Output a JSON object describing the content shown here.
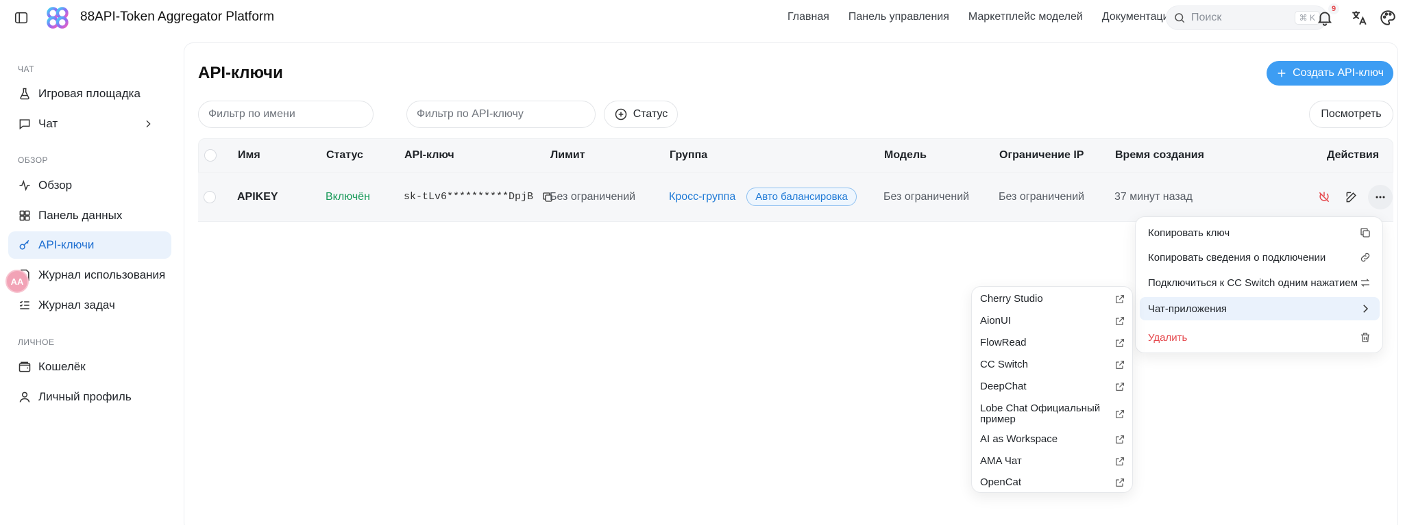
{
  "brand": {
    "name": "88API-Token Aggregator Platform"
  },
  "topnav": [
    "Главная",
    "Панель управления",
    "Маркетплейс моделей",
    "Документация"
  ],
  "search": {
    "placeholder": "Поиск",
    "shortcut": "⌘ K"
  },
  "notifications": {
    "count": "9"
  },
  "sidebar": {
    "sections": [
      {
        "title": "ЧАТ",
        "items": [
          {
            "label": "Игровая площадка",
            "icon": "flask-icon"
          },
          {
            "label": "Чат",
            "icon": "chat-icon"
          }
        ]
      },
      {
        "title": "ОБЗОР",
        "items": [
          {
            "label": "Обзор",
            "icon": "activity-icon"
          },
          {
            "label": "Панель данных",
            "icon": "grid-icon"
          },
          {
            "label": "API-ключи",
            "icon": "key-icon",
            "active": true
          },
          {
            "label": "Журнал использования",
            "icon": "document-icon"
          },
          {
            "label": "Журнал задач",
            "icon": "list-check-icon"
          }
        ]
      },
      {
        "title": "ЛИЧНОЕ",
        "items": [
          {
            "label": "Кошелёк",
            "icon": "wallet-icon"
          },
          {
            "label": "Личный профиль",
            "icon": "user-icon"
          }
        ]
      }
    ],
    "avatar_text": "AA"
  },
  "page": {
    "title": "API-ключи",
    "create_label": "Создать API-ключ",
    "filter_name_placeholder": "Фильтр по имени",
    "filter_key_placeholder": "Фильтр по API-ключу",
    "status_label": "Статус",
    "view_label": "Посмотреть"
  },
  "table": {
    "columns": [
      "Имя",
      "Статус",
      "API-ключ",
      "Лимит",
      "Группа",
      "Модель",
      "Ограничение IP",
      "Время создания",
      "Действия"
    ],
    "rows": [
      {
        "name": "APIKEY",
        "status": "Включён",
        "key": "sk-tLv6**********DpjB",
        "limit": "Без ограничений",
        "group": "Кросс-группа",
        "group_tag": "Авто балансировка",
        "model": "Без ограничений",
        "ip": "Без ограничений",
        "created": "37 минут назад"
      }
    ]
  },
  "menu": {
    "items": [
      "Копировать ключ",
      "Копировать сведения о подключении",
      "Подключиться к CC Switch одним нажатием",
      "Чат-приложения",
      "Удалить"
    ]
  },
  "submenu": {
    "items": [
      "Cherry Studio",
      "AionUI",
      "FlowRead",
      "CC Switch",
      "DeepChat",
      "Lobe Chat Официальный пример",
      "AI as Workspace",
      "AMA Чат",
      "OpenCat"
    ]
  },
  "colors": {
    "accent": "#3d9df3",
    "success": "#1a9a5a",
    "danger": "#e5484d",
    "active_bg": "#eaf2fc"
  }
}
